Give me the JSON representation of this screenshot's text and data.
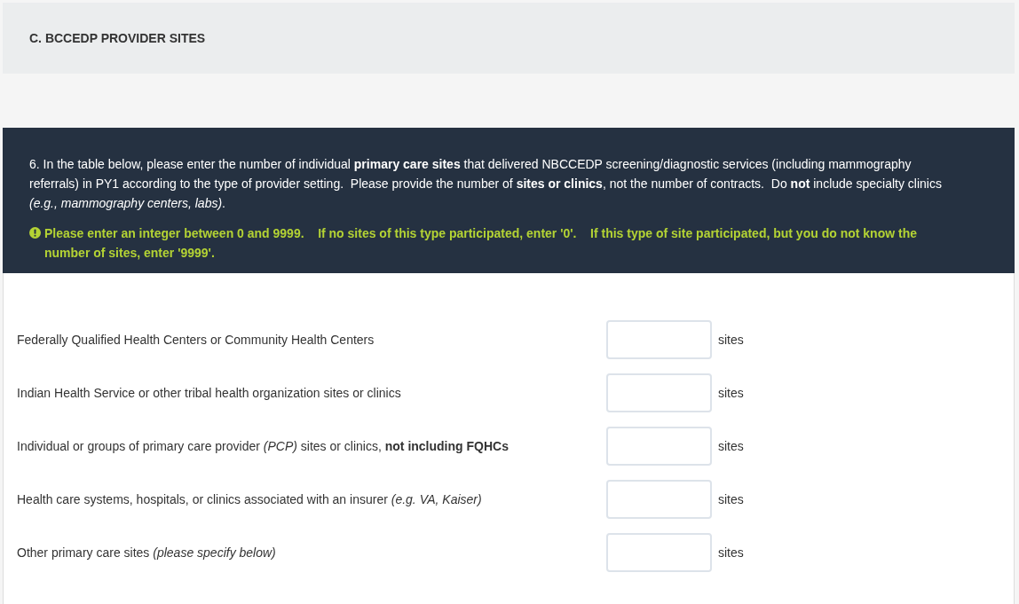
{
  "section": {
    "title": "C. BCCEDP PROVIDER SITES"
  },
  "question": {
    "text": "6. In the table below, please enter the number of individual **primary care sites** that delivered NBCCEDP screening/diagnostic services (including mammography referrals) in PY1 according to the type of provider setting.  Please provide the number of **sites or clinics**, not the number of contracts.  Do **not** include specialty clinics *(e.g., mammography centers, labs)*.",
    "warning": "Please enter an integer between 0 and 9999.    If no sites of this type participated, enter '0'.    If this type of site participated, but you do not know the number of sites, enter '9999'."
  },
  "rows": [
    {
      "label": "Federally Qualified Health Centers or Community Health Centers",
      "unit": "sites"
    },
    {
      "label": "Indian Health Service or other tribal health organization sites or clinics",
      "unit": "sites"
    },
    {
      "label": "Individual or groups of primary care provider *(PCP)* sites or clinics, **not including FQHCs**",
      "unit": "sites"
    },
    {
      "label": "Health care systems, hospitals, or clinics associated with an insurer *(e.g. VA, Kaiser)*",
      "unit": "sites"
    },
    {
      "label": "Other primary care sites *(please specify below)*",
      "unit": "sites"
    }
  ]
}
